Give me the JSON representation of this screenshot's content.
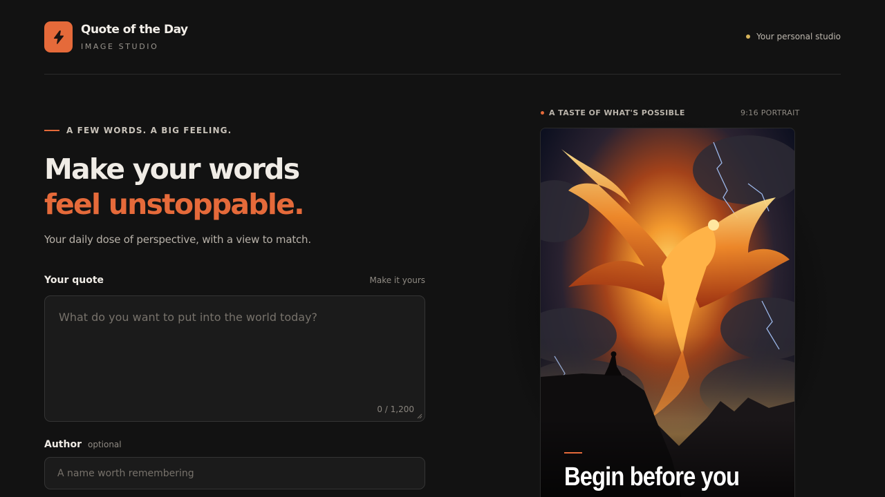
{
  "header": {
    "brand_name": "Quote of the Day",
    "brand_sub": "IMAGE STUDIO",
    "studio_tag": "Your personal studio",
    "logo_icon": "lightning-bolt-icon"
  },
  "hero": {
    "eyebrow": "A FEW WORDS. A BIG FEELING.",
    "headline_line1": "Make your words",
    "headline_line2": "feel unstoppable.",
    "tagline": "Your daily dose of perspective, with a view to match."
  },
  "form": {
    "quote_label": "Your quote",
    "quote_hint": "Make it yours",
    "quote_placeholder": "What do you want to put into the world today?",
    "quote_counter": "0 / 1,200",
    "author_label": "Author",
    "author_optional": "optional",
    "author_placeholder": "A name worth remembering"
  },
  "preview": {
    "eyebrow": "A TASTE OF WHAT'S POSSIBLE",
    "format": "9:16 PORTRAIT",
    "card_quote": "Begin before you"
  },
  "colors": {
    "accent": "#e56a3a",
    "background": "#121212",
    "status_dot": "#d6b35a"
  }
}
